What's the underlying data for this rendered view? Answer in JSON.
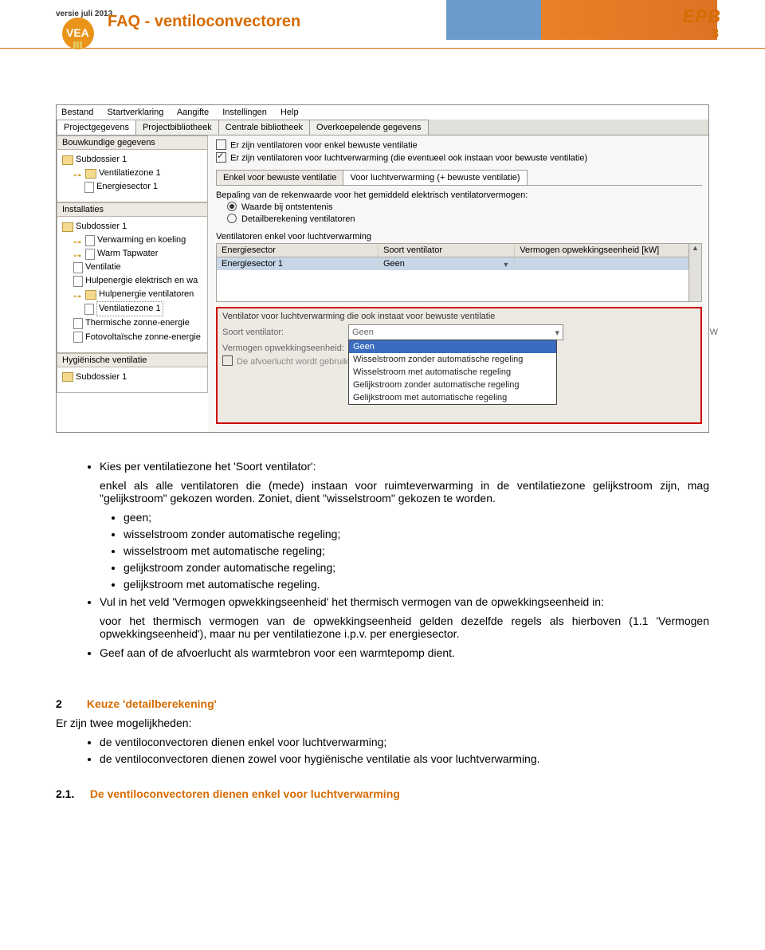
{
  "header": {
    "version": "versie juli 2013",
    "title": "FAQ - ventiloconvectoren",
    "epb": "EPB",
    "page": "3",
    "logo_text": "VEA"
  },
  "app": {
    "menu": {
      "bestand": "Bestand",
      "startverklaring": "Startverklaring",
      "aangifte": "Aangifte",
      "instellingen": "Instellingen",
      "help": "Help"
    },
    "tabs": [
      "Projectgegevens",
      "Projectbibliotheek",
      "Centrale bibliotheek",
      "Overkoepelende gegevens"
    ],
    "panel_bouw": "Bouwkundige gegevens",
    "tree1": {
      "sub": "Subdossier 1",
      "vent": "Ventilatiezone 1",
      "energ": "Energiesector 1"
    },
    "panel_inst": "Installaties",
    "tree2": {
      "sub": "Subdossier 1",
      "verw": "Verwarming en koeling",
      "tap": "Warm Tapwater",
      "vent": "Ventilatie",
      "hulp_el": "Hulpenergie elektrisch en wa",
      "hulp_vent": "Hulpenergie ventilatoren",
      "zone": "Ventilatiezone 1",
      "zon": "Thermische zonne-energie",
      "foto": "Fotovoltaïsche zonne-energie"
    },
    "panel_hyg": "Hygiënische ventilatie",
    "tree3": {
      "sub": "Subdossier 1"
    },
    "chk1": "Er zijn ventilatoren voor enkel bewuste ventilatie",
    "chk2": "Er zijn ventilatoren voor luchtverwarming (die eventueel ook instaan voor bewuste ventilatie)",
    "subtabs": [
      "Enkel voor bewuste ventilatie",
      "Voor luchtverwarming (+ bewuste ventilatie)"
    ],
    "calc_lbl": "Bepaling van de rekenwaarde voor het gemiddeld elektrisch ventilatorvermogen:",
    "radio_a": "Waarde bij ontstentenis",
    "radio_b": "Detailberekening ventilatoren",
    "table_title": "Ventilatoren enkel voor luchtverwarming",
    "cols": {
      "c1": "Energiesector",
      "c2": "Soort ventilator",
      "c3": "Vermogen opwekkingseenheid [kW]"
    },
    "row": {
      "c1": "Energiesector 1",
      "c2": "Geen"
    },
    "redbox": {
      "title": "Ventilator voor luchtverwarming die ook instaat voor bewuste ventilatie",
      "soort": "Soort ventilator:",
      "verm": "Vermogen opwekkingseenheid:",
      "dd_val": "Geen",
      "opts": [
        "Geen",
        "Wisselstroom zonder automatische regeling",
        "Wisselstroom met automatische regeling",
        "Gelijkstroom zonder automatische regeling",
        "Gelijkstroom met automatische regeling"
      ],
      "afvoer": "De afvoerlucht wordt gebruikt als",
      "kw": "W"
    }
  },
  "body": {
    "b1": "Kies per ventilatiezone het 'Soort ventilator':",
    "b2": "enkel als alle ventilatoren die (mede) instaan voor ruimteverwarming in de ventilatiezone gelijkstroom zijn, mag \"gelijkstroom\" gekozen worden. Zoniet, dient \"wisselstroom\" gekozen te worden.",
    "b3a": "geen;",
    "b3b": "wisselstroom zonder automatische regeling;",
    "b3c": "wisselstroom met automatische regeling;",
    "b3d": "gelijkstroom zonder automatische regeling;",
    "b3e": "gelijkstroom met automatische regeling.",
    "b4": "Vul in het veld 'Vermogen opwekkingseenheid' het thermisch vermogen van de opwekkingseenheid in:",
    "b5": "voor het thermisch vermogen van de opwekkingseenheid gelden dezelfde regels als hierboven (1.1 'Vermogen opwekkingseenheid'), maar nu per ventilatiezone i.p.v. per energiesector.",
    "b6": "Geef aan of de afvoerlucht als warmtebron voor een warmtepomp dient.",
    "sec2_num": "2",
    "sec2_title": "Keuze 'detailberekening'",
    "sec2_intro": "Er zijn twee mogelijkheden:",
    "opt1": "de ventiloconvectoren dienen enkel voor luchtverwarming;",
    "opt2": "de ventiloconvectoren dienen zowel voor hygiënische ventilatie als voor luchtverwarming.",
    "sec21_num": "2.1.",
    "sec21_title": "De ventiloconvectoren dienen enkel voor luchtverwarming"
  }
}
